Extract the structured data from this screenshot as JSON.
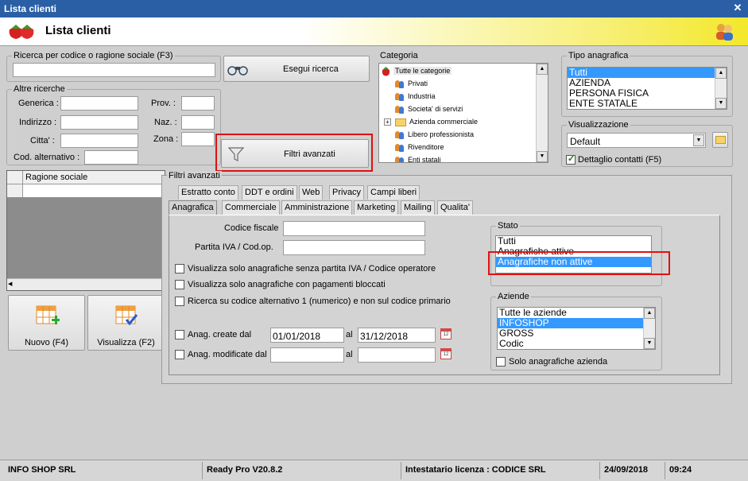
{
  "window": {
    "title": "Lista clienti",
    "close": "✕"
  },
  "header": {
    "title": "Lista clienti"
  },
  "search": {
    "group_label": "Ricerca per codice o ragione sociale (F3)",
    "button_label": "Esegui ricerca"
  },
  "altre": {
    "group_label": "Altre ricerche",
    "generica": "Generica :",
    "indirizzo": "Indirizzo :",
    "citta": "Citta' :",
    "cod_alt": "Cod. alternativo :",
    "prov": "Prov. :",
    "naz": "Naz. :",
    "zona": "Zona :"
  },
  "filtri_button": "Filtri avanzati",
  "categoria": {
    "label": "Categoria",
    "items": [
      "Tutte le categorie",
      "Privati",
      "Industria",
      "Societa' di servizi",
      "Azienda commerciale",
      "Libero professionista",
      "Rivenditore",
      "Enti statali"
    ]
  },
  "tipo": {
    "label": "Tipo anagrafica",
    "items": [
      "Tutti",
      "AZIENDA",
      "PERSONA FISICA",
      "ENTE STATALE"
    ]
  },
  "visualizzazione": {
    "label": "Visualizzazione",
    "value": "Default",
    "dettaglio": "Dettaglio contatti (F5)"
  },
  "grid": {
    "col": "Ragione sociale"
  },
  "actions": {
    "nuovo": "Nuovo (F4)",
    "visualizza": "Visualizza (F2)"
  },
  "filtri": {
    "title": "Filtri avanzati",
    "tabs_top": [
      "Estratto conto",
      "DDT e ordini",
      "Web",
      "Privacy",
      "Campi liberi"
    ],
    "tabs_bottom": [
      "Anagrafica",
      "Commerciale",
      "Amministrazione",
      "Marketing",
      "Mailing",
      "Qualita'"
    ],
    "codice_fiscale": "Codice fiscale",
    "partita_iva": "Partita IVA / Cod.op.",
    "chk1": "Visualizza solo anagrafiche senza partita IVA / Codice operatore",
    "chk2": "Visualizza solo anagrafiche con pagamenti bloccati",
    "chk3": "Ricerca su codice alternativo 1 (numerico)  e non sul codice primario",
    "create_label": "Anag. create dal",
    "create_from": "01/01/2018",
    "create_to": "31/12/2018",
    "mod_label": "Anag. modificate dal",
    "al": "al",
    "stato_label": "Stato",
    "stato_items": [
      "Tutti",
      "Anagrafiche attive",
      "Anagrafiche non attive"
    ],
    "aziende_label": "Aziende",
    "aziende_items": [
      "Tutte le aziende",
      "INFOSHOP",
      "GROSS",
      "Codic"
    ],
    "solo_aziende": "Solo anagrafiche azienda"
  },
  "status": {
    "company": "INFO SHOP SRL",
    "version": "Ready Pro V20.8.2",
    "license": "Intestatario licenza : CODICE SRL",
    "date": "24/09/2018",
    "time": "09:24"
  }
}
